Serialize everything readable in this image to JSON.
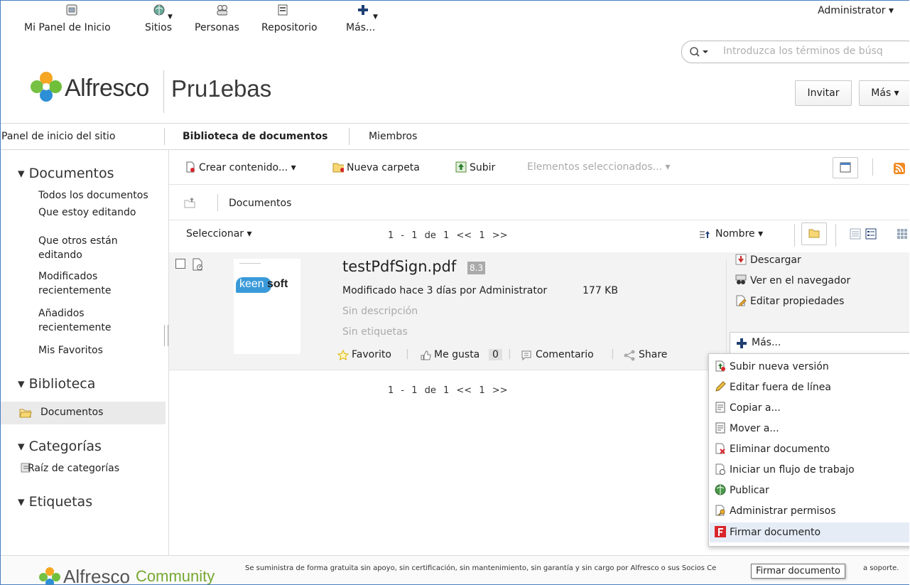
{
  "app_nav": {
    "dashboard": "Mi Panel de Inicio",
    "sites": "Sitios",
    "people": "Personas",
    "repository": "Repositorio",
    "more": "Más..."
  },
  "user_menu": "Administrator ▾",
  "search": {
    "placeholder": "Introduzca los términos de búsq"
  },
  "brand": "Alfresco",
  "site": {
    "title": "Pru1ebas",
    "invite_label": "Invitar",
    "more_label": "Más ▾"
  },
  "site_nav": {
    "dashboard": "Panel de inicio del sitio",
    "doclib": "Biblioteca de documentos",
    "members": "Miembros"
  },
  "sidebar": {
    "documents_header": "▾ Documentos",
    "filters": [
      "Todos los documentos",
      "Que estoy editando",
      "Que otros están editando",
      "Modificados recientemente",
      "Añadidos recientemente",
      "Mis Favoritos"
    ],
    "library_header": "▾ Biblioteca",
    "library_item": "Documentos",
    "categories_header": "▾ Categorías",
    "categories_root": "Raíz de categorías",
    "tags_header": "▾ Etiquetas"
  },
  "toolbar": {
    "create": "Crear contenido... ▾",
    "new_folder": "Nueva carpeta",
    "upload": "Subir",
    "selected": "Elementos seleccionados... ▾"
  },
  "path": {
    "crumb": "Documentos"
  },
  "list": {
    "select": "Seleccionar ▾",
    "pagination": "1 - 1 de 1 << 1 >>",
    "sort": "Nombre ▾"
  },
  "document": {
    "thumb_text_a": "keen",
    "thumb_text_b": "soft",
    "name": "testPdfSign.pdf",
    "version": "8.3",
    "modified": "Modificado hace 3 días por Administrator",
    "size": "177 KB",
    "description": "Sin descripción",
    "tags": "Sin etiquetas",
    "favorite": "Favorito",
    "like": "Me gusta",
    "like_count": "0",
    "comment": "Comentario",
    "share": "Share"
  },
  "actions": {
    "download": "Descargar",
    "view_browser": "Ver en el navegador",
    "edit_props": "Editar propiedades",
    "more": "Más..."
  },
  "more_menu": [
    "Subir nueva versión",
    "Editar fuera de línea",
    "Copiar a...",
    "Mover a...",
    "Eliminar documento",
    "Iniciar un flujo de trabajo",
    "Publicar",
    "Administrar permisos",
    "Firmar documento"
  ],
  "footer": {
    "brand": "Alfresco",
    "brand_suffix": "Community",
    "notice": "Se suministra de forma gratuita sin apoyo, sin certificación, sin mantenimiento, sin garantía y sin cargo por Alfresco o sus Socios Ce",
    "notice_tail": "a soporte."
  },
  "tooltip": "Firmar documento",
  "colors": {
    "accent": "#4a7fc0",
    "highlight": "#e5ecf6",
    "sign_red": "#d9262c"
  }
}
